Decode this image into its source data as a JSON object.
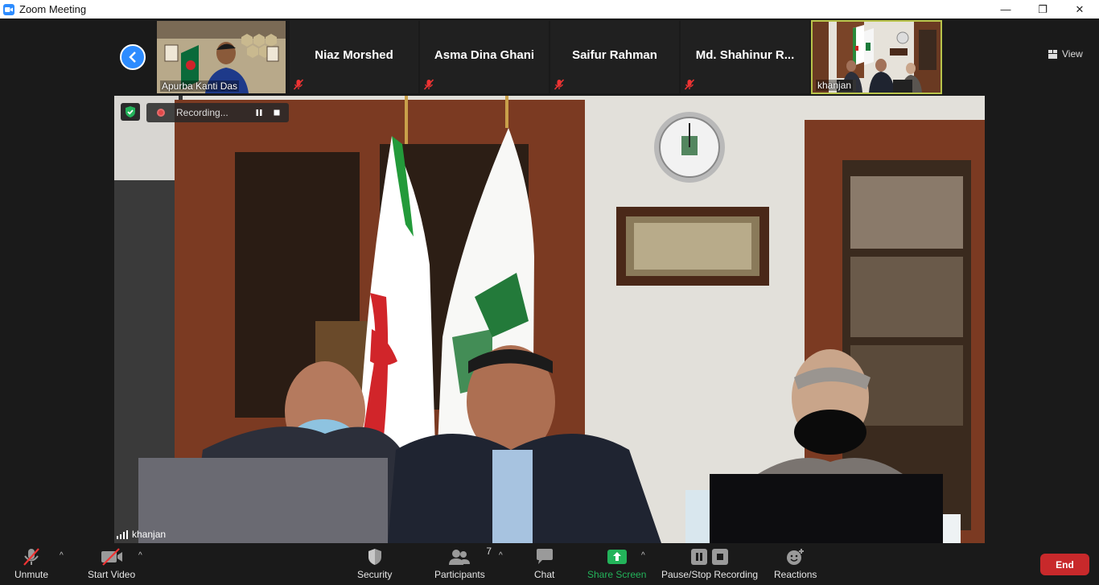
{
  "window": {
    "title": "Zoom Meeting",
    "minimize": "—",
    "restore": "❐",
    "close": "✕"
  },
  "strip": {
    "tiles": [
      {
        "name": "Apurba Kanti Das",
        "has_video": true
      },
      {
        "name": "Niaz Morshed",
        "muted": true
      },
      {
        "name": "Asma Dina Ghani",
        "muted": true
      },
      {
        "name": "Saifur Rahman",
        "muted": true
      },
      {
        "name": "Md.  Shahinur  R...",
        "muted": true
      },
      {
        "name": "khanjan",
        "has_video": true,
        "active": true
      }
    ]
  },
  "view_button": {
    "label": "View",
    "icon": "grid-icon"
  },
  "recording": {
    "status": "Recording...",
    "pause_icon": "pause-icon",
    "stop_icon": "stop-icon"
  },
  "main_video": {
    "speaker": "khanjan"
  },
  "toolbar": {
    "unmute": "Unmute",
    "start_video": "Start Video",
    "security": "Security",
    "participants": "Participants",
    "participants_count": "7",
    "chat": "Chat",
    "share_screen": "Share Screen",
    "pause_stop_recording": "Pause/Stop Recording",
    "reactions": "Reactions",
    "end": "End"
  },
  "colors": {
    "accent": "#2d8cff",
    "share_green": "#23b35a",
    "end_red": "#c8292b",
    "active_border": "#b8c34a"
  }
}
